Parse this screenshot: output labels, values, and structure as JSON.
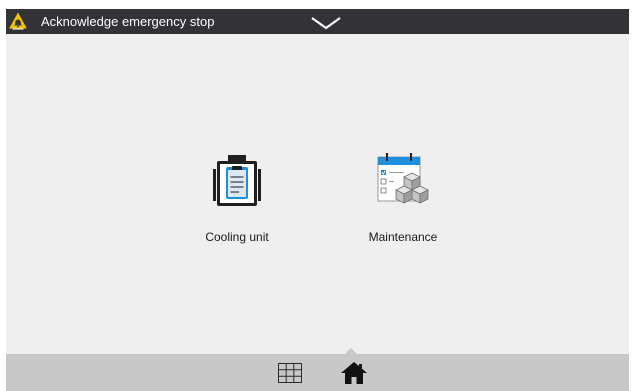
{
  "alarm_bar": {
    "message": "Acknowledge emergency stop",
    "icon": "warning-bell-icon",
    "toggle_icon": "chevron-down-icon"
  },
  "tiles": [
    {
      "label": "Cooling unit",
      "icon": "cooling-unit-icon"
    },
    {
      "label": "Maintenance",
      "icon": "maintenance-icon"
    }
  ],
  "nav": {
    "items": [
      {
        "icon": "grid-icon"
      },
      {
        "icon": "home-icon",
        "active": true
      }
    ]
  },
  "colors": {
    "top_bar": "#323237",
    "background": "#efefef",
    "nav_bar": "#c8c8c8",
    "accent_blue": "#1e8fdc",
    "warning_yellow": "#f2c200"
  }
}
